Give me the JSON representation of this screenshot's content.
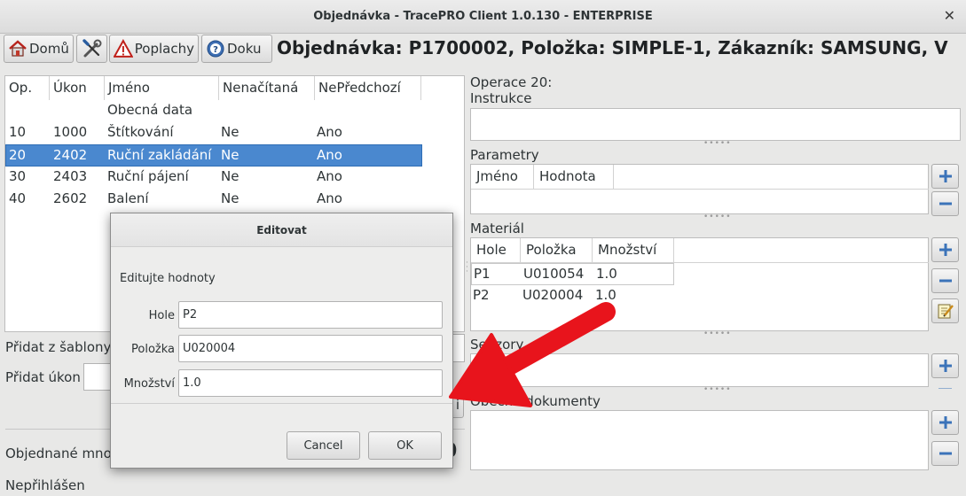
{
  "window": {
    "title": "Objednávka - TracePRO Client 1.0.130 - ENTERPRISE",
    "close_glyph": "✕"
  },
  "toolbar": {
    "home_label": "Domů",
    "tools_icon": "wrench-screwdriver-icon",
    "alarms_label": "Poplachy",
    "docs_label": "Doku",
    "heading": "Objednávka: P1700002, Položka: SIMPLE-1, Zákazník: SAMSUNG, V"
  },
  "operations": {
    "columns": [
      "Op.",
      "Úkon",
      "Jméno",
      "Nenačítaná",
      "NePředchozí"
    ],
    "rows": [
      {
        "op": "",
        "ukon": "",
        "jmeno": "Obecná data",
        "nenacitana": "",
        "nepredchozi": "",
        "selected": false
      },
      {
        "op": "10",
        "ukon": "1000",
        "jmeno": "Štítkování",
        "nenacitana": "Ne",
        "nepredchozi": "Ano",
        "selected": false
      },
      {
        "op": "20",
        "ukon": "2402",
        "jmeno": "Ruční zakládání",
        "nenacitana": "Ne",
        "nepredchozi": "Ano",
        "selected": true
      },
      {
        "op": "30",
        "ukon": "2403",
        "jmeno": "Ruční pájení",
        "nenacitana": "Ne",
        "nepredchozi": "Ano",
        "selected": false
      },
      {
        "op": "40",
        "ukon": "2602",
        "jmeno": "Balení",
        "nenacitana": "Ne",
        "nepredchozi": "Ano",
        "selected": false
      }
    ]
  },
  "left_bottom": {
    "add_from_template": "Přidat z šablony",
    "add_task": "Přidat úkon",
    "btn_fragment": "i",
    "ordered_qty": "Objednané mno",
    "ordered_value_fragment": "0",
    "status": "Nepřihlášen"
  },
  "right": {
    "operation_label": "Operace 20:",
    "instructions_label": "Instrukce",
    "params_label": "Parametry",
    "params_columns": [
      "Jméno",
      "Hodnota"
    ],
    "material_label": "Materiál",
    "material_columns": [
      "Hole",
      "Položka",
      "Množství"
    ],
    "material_rows": [
      {
        "hole": "P1",
        "polozka": "U010054",
        "mnozstvi": "1.0"
      },
      {
        "hole": "P2",
        "polozka": "U020004",
        "mnozstvi": "1.0"
      }
    ],
    "sensors_label": "Senzory",
    "docs_label": "Obecné dokumenty"
  },
  "dialog": {
    "title": "Editovat",
    "subtitle": "Editujte hodnoty",
    "fields": [
      {
        "label": "Hole",
        "value": "P2"
      },
      {
        "label": "Položka",
        "value": "U020004"
      },
      {
        "label": "Množství",
        "value": "1.0"
      }
    ],
    "cancel_label": "Cancel",
    "ok_label": "OK"
  },
  "colors": {
    "selection": "#4a88cf",
    "arrow": "#e8141c",
    "add_icon": "#3b73b9",
    "remove_icon": "#3b73b9"
  }
}
